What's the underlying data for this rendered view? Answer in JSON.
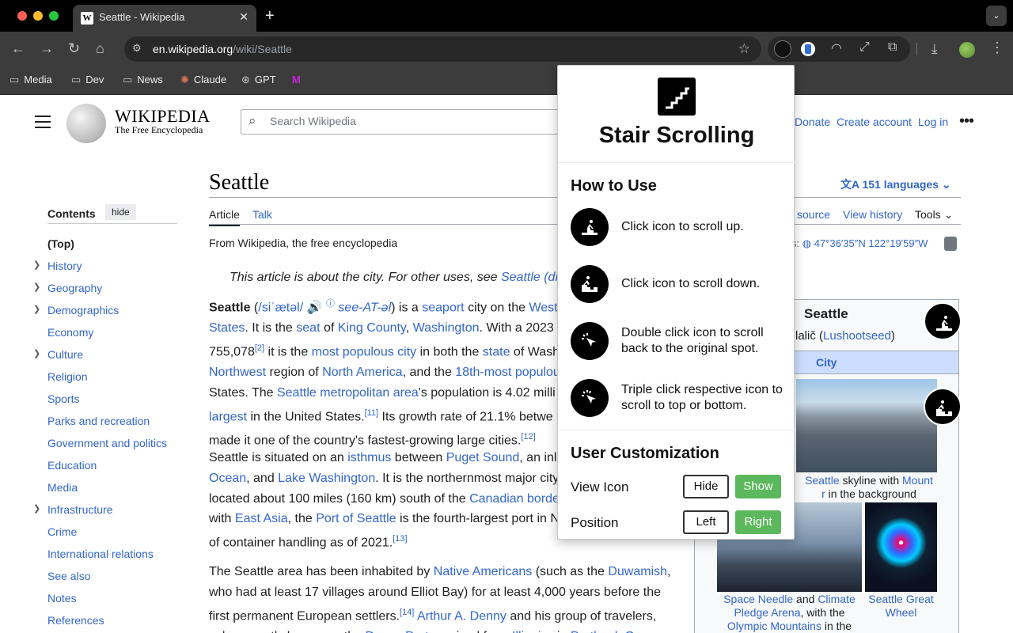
{
  "browser": {
    "tab_title": "Seattle - Wikipedia",
    "tab_close": "✕",
    "new_tab": "+",
    "url_host": "en.wikipedia.org",
    "url_path": "/wiki/Seattle",
    "bookmarks": [
      "Media",
      "Dev",
      "News",
      "Claude",
      "GPT"
    ]
  },
  "wiki": {
    "wordmark": "WIKIPEDIA",
    "tagline": "The Free Encyclopedia",
    "search_placeholder": "Search Wikipedia",
    "top_links": [
      "Donate",
      "Create account",
      "Log in"
    ],
    "toc": {
      "title": "Contents",
      "hide": "hide",
      "items": [
        "(Top)",
        "History",
        "Geography",
        "Demographics",
        "Economy",
        "Culture",
        "Religion",
        "Sports",
        "Parks and recreation",
        "Government and politics",
        "Education",
        "Media",
        "Infrastructure",
        "Crime",
        "International relations",
        "See also",
        "Notes",
        "References"
      ]
    },
    "title": "Seattle",
    "languages": "151 languages",
    "tabs": [
      "Article",
      "Talk"
    ],
    "right_tabs": [
      "source",
      "View history",
      "Tools"
    ],
    "from": "From Wikipedia, the free encyclopedia",
    "coords_prefix": "s:",
    "coords": "47°36′35″N 122°19′59″W",
    "hatnote_text": "This article is about the city. For other uses, see ",
    "hatnote_link": "Seattle (di",
    "infobox": {
      "title": "Seattle",
      "native": "lalič",
      "native_link": "Lushootseed",
      "type": "City",
      "cap1_link1": "Seattle",
      "cap1_text1": " skyline with ",
      "cap1_link2": "Mount",
      "cap1_link3": "r",
      "cap1_text2": " in the background",
      "cap2_link1": "Space Needle",
      "cap2_text1": " and ",
      "cap2_link2": "Climate Pledge Arena",
      "cap2_text2": ", with the ",
      "cap2_link3": "Olympic Mountains",
      "cap2_text3": " in the",
      "cap3_link": "Seattle Great Wheel"
    }
  },
  "popup": {
    "title": "Stair Scrolling",
    "how_to": "How to Use",
    "steps": [
      "Click icon to scroll up.",
      "Click icon to scroll down.",
      "Double click icon to scroll back to the original spot.",
      "Triple click respective icon to scroll to top or bottom."
    ],
    "customization": "User Customization",
    "view_icon_label": "View Icon",
    "hide": "Hide",
    "show": "Show",
    "position_label": "Position",
    "left": "Left",
    "right": "Right",
    "accent": "#5cb85c"
  }
}
